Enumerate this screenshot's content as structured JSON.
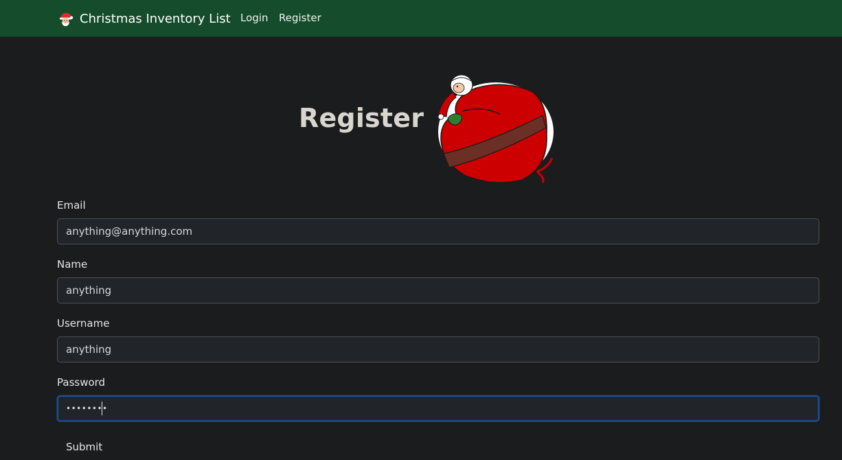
{
  "navbar": {
    "brand_icon": "santa-face-icon",
    "brand_text": "Christmas Inventory List",
    "links": [
      {
        "label": "Login"
      },
      {
        "label": "Register"
      }
    ]
  },
  "page": {
    "title": "Register",
    "illustration": "santa-with-giant-sack-image"
  },
  "form": {
    "email": {
      "label": "Email",
      "value": "anything@anything.com"
    },
    "name": {
      "label": "Name",
      "value": "anything"
    },
    "username": {
      "label": "Username",
      "value": "anything"
    },
    "password": {
      "label": "Password",
      "value": "••••••••",
      "focused": true
    },
    "submit_label": "Submit"
  },
  "colors": {
    "navbar_bg": "#144c2c",
    "page_bg": "#1b1c1e",
    "input_bg": "#212529",
    "focus_ring": "#1a4f9c",
    "sack_red": "#cc0000"
  }
}
